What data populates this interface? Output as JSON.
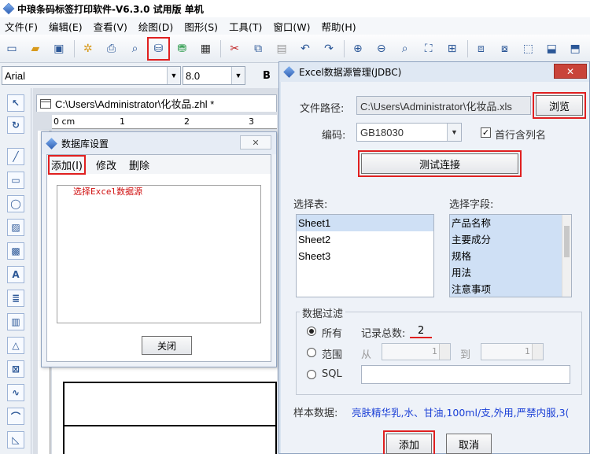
{
  "window": {
    "title": "中琅条码标签打印软件-V6.3.0 试用版 单机"
  },
  "menu": [
    "文件(F)",
    "编辑(E)",
    "查看(V)",
    "绘图(D)",
    "图形(S)",
    "工具(T)",
    "窗口(W)",
    "帮助(H)"
  ],
  "format": {
    "font": "Arial",
    "size": "8.0",
    "bold": "B"
  },
  "document": {
    "tab": "C:\\Users\\Administrator\\化妆品.zhl *",
    "ruler": [
      "0 cm",
      "1",
      "2",
      "3"
    ]
  },
  "db_dialog": {
    "title": "数据库设置",
    "menu": {
      "add": "添加(I)",
      "edit": "修改",
      "delete": "删除"
    },
    "hint": "选择Excel数据源",
    "close": "关闭"
  },
  "excel_dialog": {
    "title": "Excel数据源管理(JDBC)",
    "file_label": "文件路径:",
    "file_path": "C:\\Users\\Administrator\\化妆品.xls",
    "browse": "浏览",
    "encoding_label": "编码:",
    "encoding": "GB18030",
    "header_checkbox": "首行含列名",
    "test": "测试连接",
    "tables_label": "选择表:",
    "tables": [
      "Sheet1",
      "Sheet2",
      "Sheet3"
    ],
    "fields_label": "选择字段:",
    "fields": [
      "产品名称",
      "主要成分",
      "规格",
      "用法",
      "注意事项"
    ],
    "filter": {
      "title": "数据过滤",
      "all": "所有",
      "count_label": "记录总数:",
      "count": "2",
      "range": "范围",
      "from": "从",
      "to": "到",
      "from_value": "1",
      "to_value": "1",
      "sql": "SQL"
    },
    "sample_label": "样本数据:",
    "sample_value": "亮肤精华乳,水、甘油,100ml/支,外用,严禁内服,3(",
    "add": "添加",
    "cancel": "取消"
  },
  "colors": {
    "highlight": "#e02020",
    "sample_text": "#1a3fd6"
  }
}
